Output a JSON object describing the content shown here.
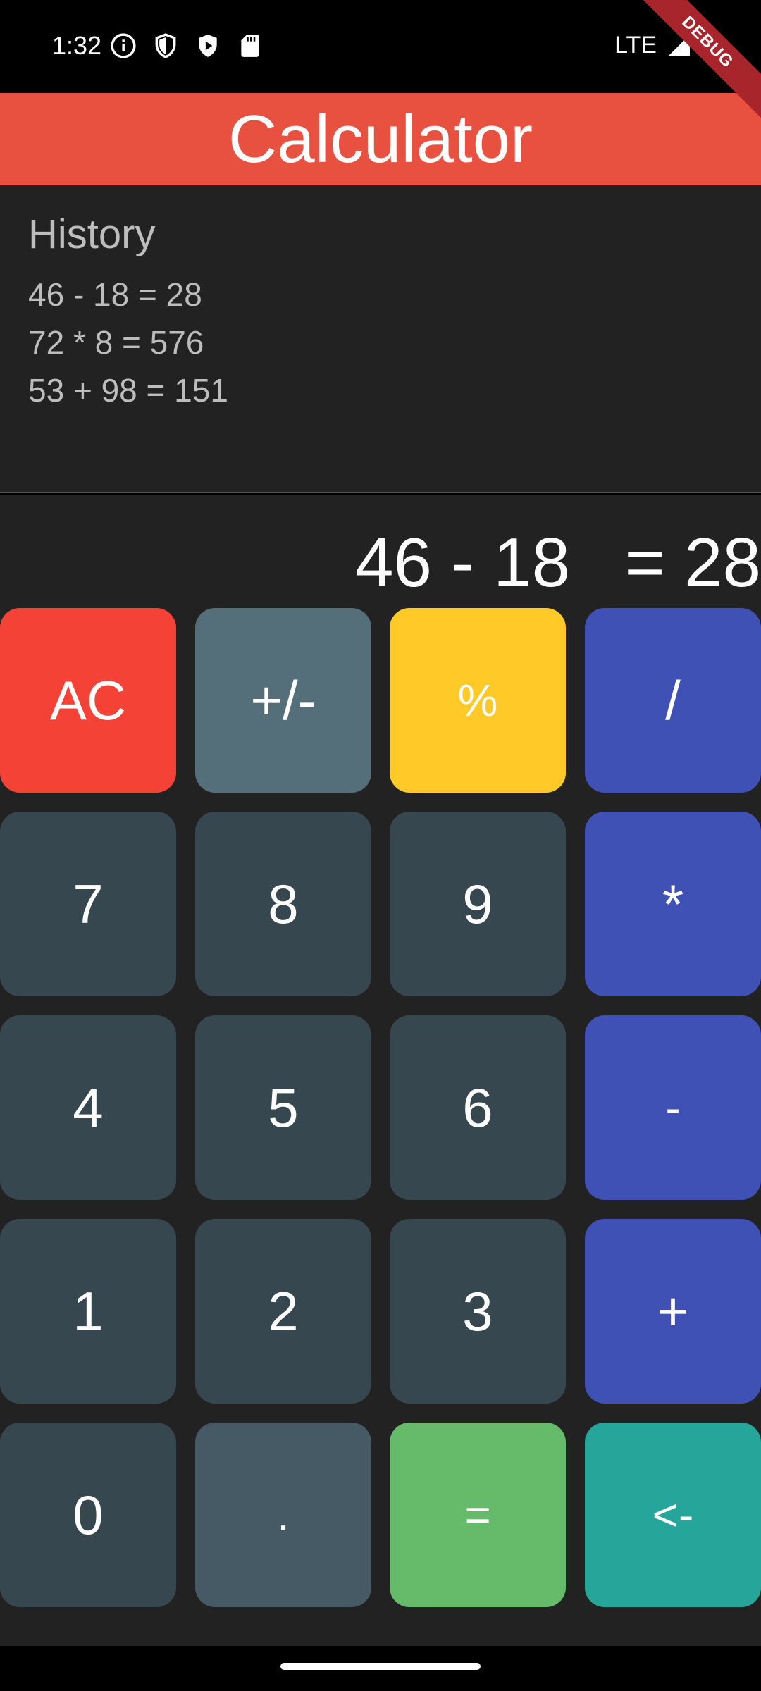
{
  "status": {
    "time": "1:32",
    "network": "LTE",
    "icons": [
      "info-icon",
      "shield-icon",
      "play-protect-icon",
      "sd-card-icon",
      "signal-icon",
      "battery-icon"
    ]
  },
  "debug_banner": "DEBUG",
  "appbar": {
    "title": "Calculator",
    "color": "#e8503f"
  },
  "history": {
    "title": "History",
    "items": [
      "46 - 18 = 28",
      "72 * 8 = 576",
      "53 + 98 = 151"
    ]
  },
  "display": {
    "expression": "46 - 18",
    "result": "= 28"
  },
  "keys": {
    "ac": "AC",
    "sign": "+/-",
    "percent": "%",
    "divide": "/",
    "seven": "7",
    "eight": "8",
    "nine": "9",
    "multiply": "*",
    "four": "4",
    "five": "5",
    "six": "6",
    "minus": "-",
    "one": "1",
    "two": "2",
    "three": "3",
    "plus": "+",
    "zero": "0",
    "dot": ".",
    "equals": "=",
    "backspace": "<-"
  }
}
